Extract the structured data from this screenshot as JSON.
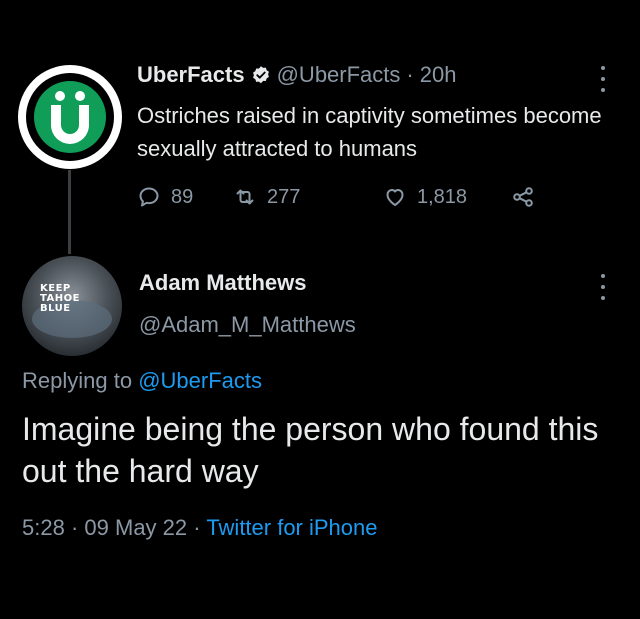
{
  "tweet1": {
    "avatar_letter": "Ü",
    "display_name": "UberFacts",
    "handle": "@UberFacts",
    "separator": "·",
    "time": "20h",
    "text": "Ostriches raised in captivity sometimes become sexually attracted to humans",
    "reply_count": "89",
    "retweet_count": "277",
    "like_count": "1,818",
    "icons": [
      "verified-badge-icon",
      "reply-icon",
      "retweet-icon",
      "like-icon",
      "share-icon",
      "more-icon"
    ]
  },
  "tweet2": {
    "avatar_text": [
      "KEEP",
      "TAHOE",
      "BLUE"
    ],
    "display_name": "Adam Matthews",
    "handle": "@Adam_M_Matthews",
    "replying_prefix": "Replying to",
    "replying_to": "@UberFacts",
    "text": "Imagine being the person who found this out the hard way",
    "time": "5:28",
    "separator": "·",
    "date": "09 May 22",
    "source": "Twitter for iPhone"
  },
  "colors": {
    "background": "#000000",
    "text": "#e7e9ea",
    "muted": "#8b98a5",
    "link": "#1d9bf0",
    "avatar_green": "#0f9d58"
  }
}
